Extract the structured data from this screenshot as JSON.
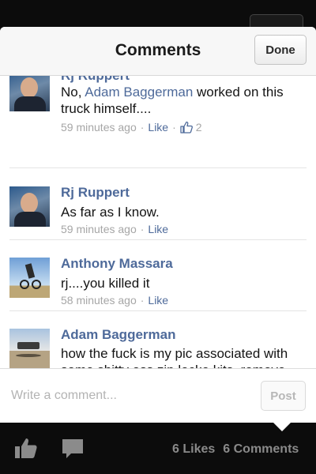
{
  "header": {
    "title": "Comments",
    "done_label": "Done"
  },
  "comments": [
    {
      "author": "Rj Ruppert",
      "text_before": "No, ",
      "mention": "Adam Baggerman",
      "text_after": " worked on this truck himself....",
      "time": "59 minutes ago",
      "like_label": "Like",
      "like_count": "2"
    },
    {
      "author": "Rj Ruppert",
      "text": "As far as I know.",
      "time": "59 minutes ago",
      "like_label": "Like"
    },
    {
      "author": "Anthony Massara",
      "text": "rj....you killed it",
      "time": "58 minutes ago",
      "like_label": "Like"
    },
    {
      "author": "Adam Baggerman",
      "text": "how the fuck is my pic associated with some shitty ass zip locke kits. remove this or ill report it"
    }
  ],
  "compose": {
    "placeholder": "Write a comment...",
    "post_label": "Post"
  },
  "footer": {
    "likes": "6 Likes",
    "comments": "6 Comments"
  },
  "colors": {
    "link": "#4e6a9a",
    "meta": "#a6a6a6",
    "background": "#0c0c0c"
  },
  "icons": [
    "thumbs-up-icon",
    "speech-bubble-icon"
  ]
}
